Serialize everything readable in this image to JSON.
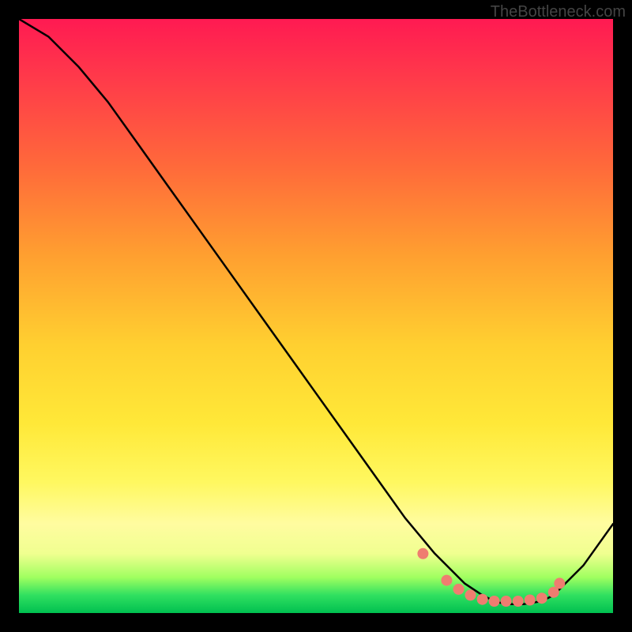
{
  "watermark": "TheBottleneck.com",
  "chart_data": {
    "type": "line",
    "title": "",
    "xlabel": "",
    "ylabel": "",
    "x": [
      0,
      5,
      10,
      15,
      20,
      25,
      30,
      35,
      40,
      45,
      50,
      55,
      60,
      65,
      70,
      72,
      75,
      78,
      80,
      82,
      85,
      88,
      90,
      95,
      100
    ],
    "values": [
      100,
      97,
      92,
      86,
      79,
      72,
      65,
      58,
      51,
      44,
      37,
      30,
      23,
      16,
      10,
      8,
      5,
      3,
      2,
      1.5,
      1.5,
      2,
      3,
      8,
      15
    ],
    "xlim": [
      0,
      100
    ],
    "ylim": [
      0,
      100
    ],
    "markers": {
      "x": [
        68,
        72,
        74,
        76,
        78,
        80,
        82,
        84,
        86,
        88,
        90,
        91
      ],
      "y": [
        10,
        5.5,
        4,
        3,
        2.3,
        2,
        2,
        2,
        2.2,
        2.5,
        3.5,
        5
      ],
      "style": "circle",
      "color": "#ef7d70"
    }
  }
}
